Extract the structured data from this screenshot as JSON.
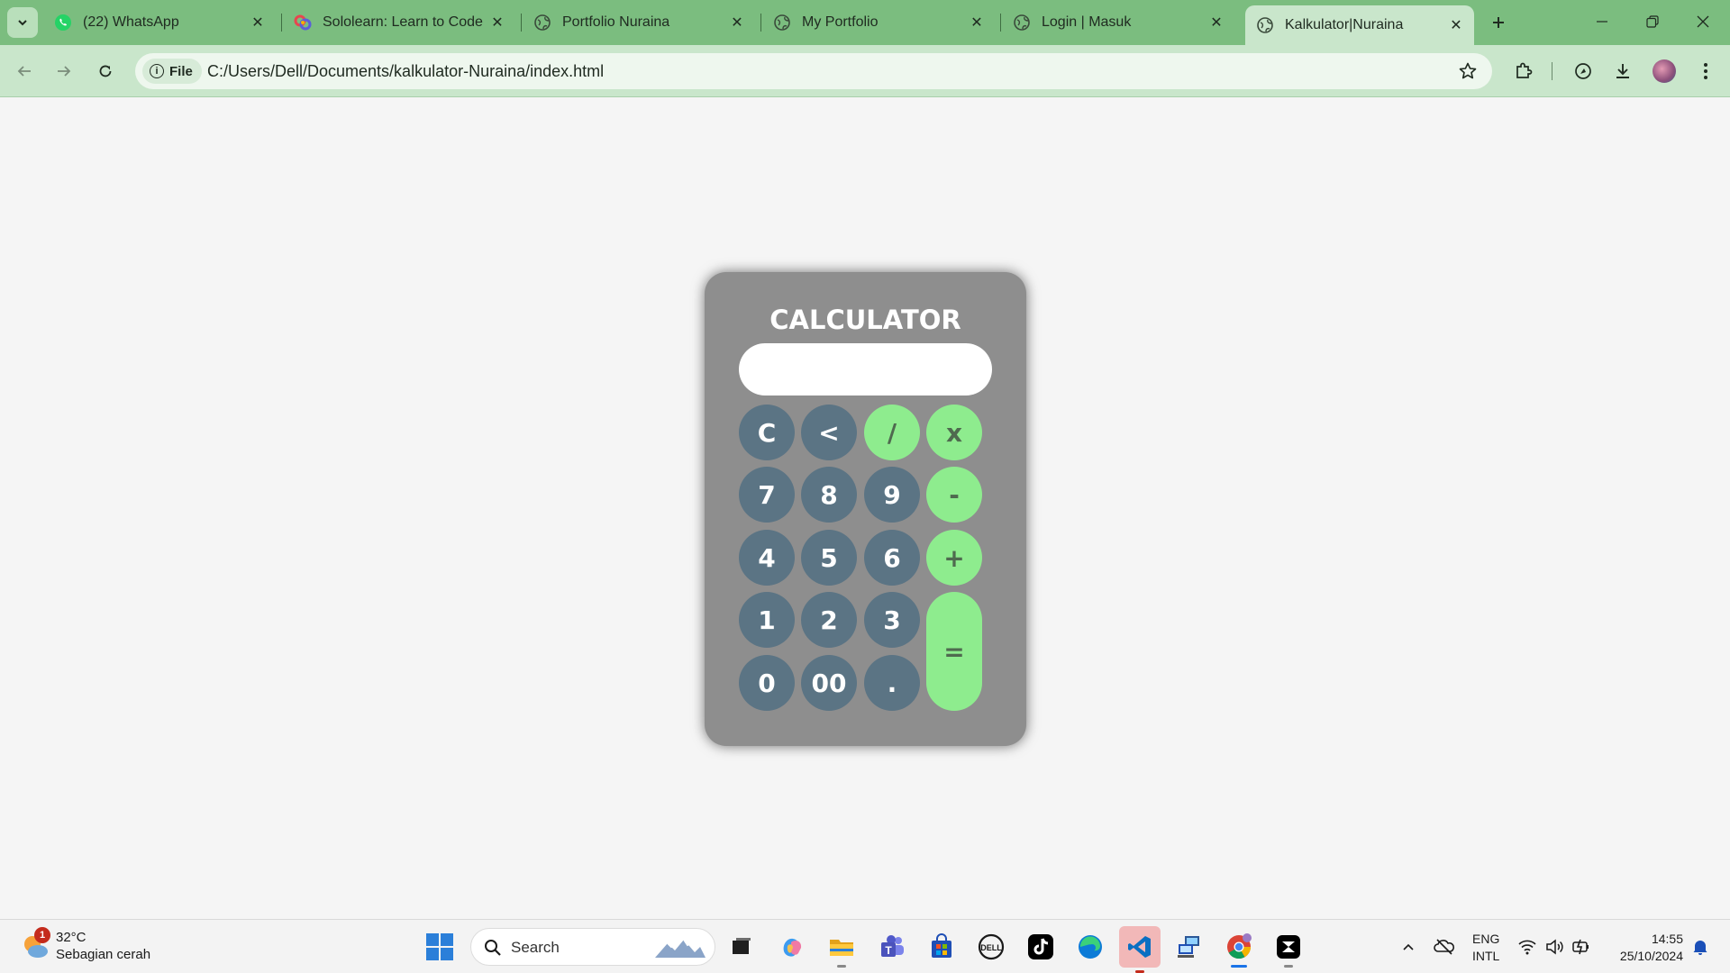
{
  "browser": {
    "tabs": [
      {
        "title": "(22) WhatsApp",
        "icon": "whatsapp-icon",
        "active": false
      },
      {
        "title": "Sololearn: Learn to Code",
        "icon": "sololearn-icon",
        "active": false
      },
      {
        "title": "Portfolio Nuraina",
        "icon": "globe-icon",
        "active": false
      },
      {
        "title": "My Portfolio",
        "icon": "globe-icon",
        "active": false
      },
      {
        "title": "Login | Masuk",
        "icon": "globe-icon",
        "active": false
      },
      {
        "title": "Kalkulator|Nuraina",
        "icon": "globe-icon",
        "active": true
      }
    ],
    "address": {
      "scheme_label": "File",
      "url": "C:/Users/Dell/Documents/kalkulator-Nuraina/index.html"
    },
    "colors": {
      "frame": "#7bbd7f",
      "toolbar": "#c9e6cb"
    }
  },
  "calculator": {
    "title": "CALCULATOR",
    "display_value": "",
    "keys": [
      {
        "label": "C",
        "type": "function"
      },
      {
        "label": "<",
        "type": "function"
      },
      {
        "label": "/",
        "type": "operator"
      },
      {
        "label": "x",
        "type": "operator"
      },
      {
        "label": "7",
        "type": "digit"
      },
      {
        "label": "8",
        "type": "digit"
      },
      {
        "label": "9",
        "type": "digit"
      },
      {
        "label": "-",
        "type": "operator"
      },
      {
        "label": "4",
        "type": "digit"
      },
      {
        "label": "5",
        "type": "digit"
      },
      {
        "label": "6",
        "type": "digit"
      },
      {
        "label": "+",
        "type": "operator"
      },
      {
        "label": "1",
        "type": "digit"
      },
      {
        "label": "2",
        "type": "digit"
      },
      {
        "label": "3",
        "type": "digit"
      },
      {
        "label": "=",
        "type": "equals"
      },
      {
        "label": "0",
        "type": "digit"
      },
      {
        "label": "00",
        "type": "digit"
      },
      {
        "label": ".",
        "type": "digit"
      }
    ],
    "colors": {
      "body": "#8e8e8e",
      "key": "#5b7484",
      "operator": "#8eec8e",
      "display": "#ffffff"
    }
  },
  "taskbar": {
    "weather": {
      "temperature": "32°C",
      "condition": "Sebagian cerah",
      "badge": "1"
    },
    "search_placeholder": "Search",
    "language": {
      "line1": "ENG",
      "line2": "INTL"
    },
    "clock": {
      "time": "14:55",
      "date": "25/10/2024"
    },
    "pinned_apps": [
      "task-view-icon",
      "copilot-icon",
      "file-explorer-icon",
      "teams-icon",
      "store-icon",
      "dell-icon",
      "tiktok-icon",
      "edge-icon",
      "vscode-icon",
      "remote-desktop-icon",
      "chrome-icon",
      "capcut-icon"
    ]
  }
}
